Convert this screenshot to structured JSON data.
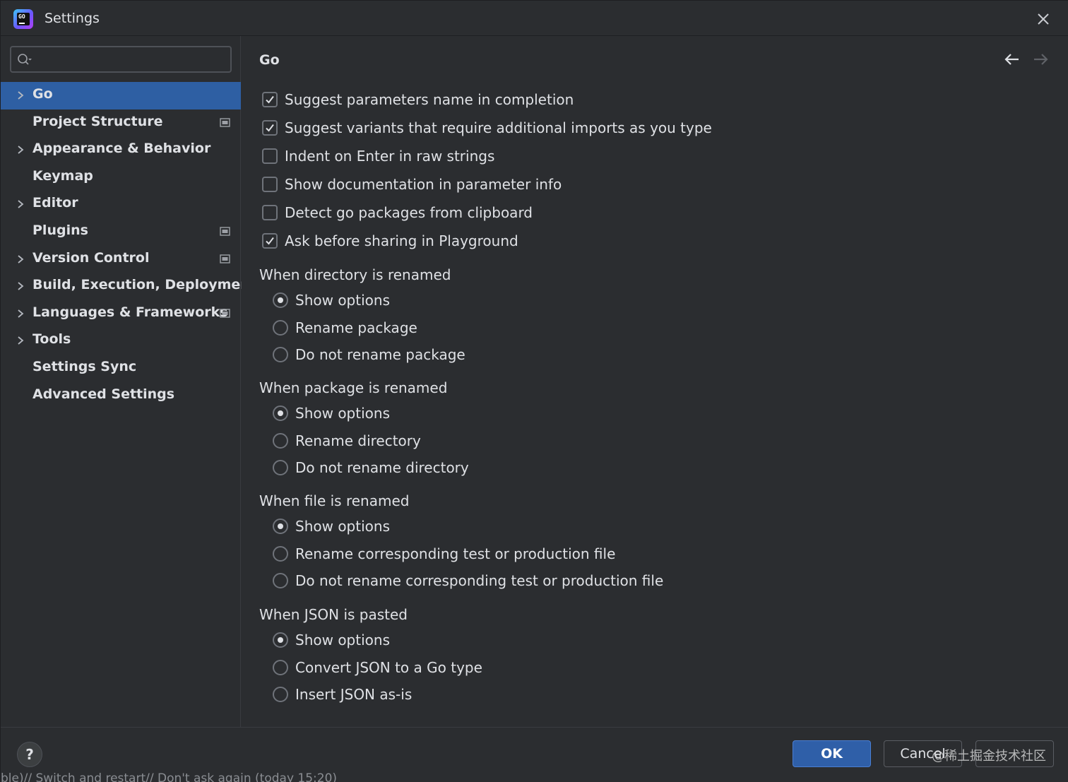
{
  "window": {
    "title": "Settings"
  },
  "sidebar": {
    "search": {
      "value": "",
      "placeholder": ""
    },
    "items": [
      {
        "label": "Go",
        "expandable": true,
        "selected": true,
        "project_icon": false
      },
      {
        "label": "Project Structure",
        "expandable": false,
        "selected": false,
        "project_icon": true
      },
      {
        "label": "Appearance & Behavior",
        "expandable": true,
        "selected": false,
        "project_icon": false
      },
      {
        "label": "Keymap",
        "expandable": false,
        "selected": false,
        "project_icon": false
      },
      {
        "label": "Editor",
        "expandable": true,
        "selected": false,
        "project_icon": false
      },
      {
        "label": "Plugins",
        "expandable": false,
        "selected": false,
        "project_icon": true
      },
      {
        "label": "Version Control",
        "expandable": true,
        "selected": false,
        "project_icon": true
      },
      {
        "label": "Build, Execution, Deployment",
        "expandable": true,
        "selected": false,
        "project_icon": false
      },
      {
        "label": "Languages & Frameworks",
        "expandable": true,
        "selected": false,
        "project_icon": true
      },
      {
        "label": "Tools",
        "expandable": true,
        "selected": false,
        "project_icon": false
      },
      {
        "label": "Settings Sync",
        "expandable": false,
        "selected": false,
        "project_icon": false
      },
      {
        "label": "Advanced Settings",
        "expandable": false,
        "selected": false,
        "project_icon": false
      }
    ]
  },
  "content": {
    "title": "Go",
    "checkboxes": [
      {
        "label": "Suggest parameters name in completion",
        "checked": true
      },
      {
        "label": "Suggest variants that require additional imports as you type",
        "checked": true
      },
      {
        "label": "Indent on Enter in raw strings",
        "checked": false
      },
      {
        "label": "Show documentation in parameter info",
        "checked": false
      },
      {
        "label": "Detect go packages from clipboard",
        "checked": false
      },
      {
        "label": "Ask before sharing in Playground",
        "checked": true
      }
    ],
    "groups": [
      {
        "heading": "When directory is renamed",
        "options": [
          {
            "label": "Show options",
            "selected": true
          },
          {
            "label": "Rename package",
            "selected": false
          },
          {
            "label": "Do not rename package",
            "selected": false
          }
        ]
      },
      {
        "heading": "When package is renamed",
        "options": [
          {
            "label": "Show options",
            "selected": true
          },
          {
            "label": "Rename directory",
            "selected": false
          },
          {
            "label": "Do not rename directory",
            "selected": false
          }
        ]
      },
      {
        "heading": "When file is renamed",
        "options": [
          {
            "label": "Show options",
            "selected": true
          },
          {
            "label": "Rename corresponding test or production file",
            "selected": false
          },
          {
            "label": "Do not rename corresponding test or production file",
            "selected": false
          }
        ]
      },
      {
        "heading": "When JSON is pasted",
        "options": [
          {
            "label": "Show options",
            "selected": true
          },
          {
            "label": "Convert JSON to a Go type",
            "selected": false
          },
          {
            "label": "Insert JSON as-is",
            "selected": false
          }
        ]
      }
    ]
  },
  "footer": {
    "help_label": "?",
    "ok_label": "OK",
    "cancel_label": "Cancel",
    "apply_label": "",
    "watermark": "@稀土掘金技术社区",
    "status_text": "ble)// Switch and restart// Don't ask again (today 15:20)"
  },
  "colors": {
    "accent": "#2e5fa3",
    "background": "#2b2d30",
    "text": "#dfe1e5"
  }
}
